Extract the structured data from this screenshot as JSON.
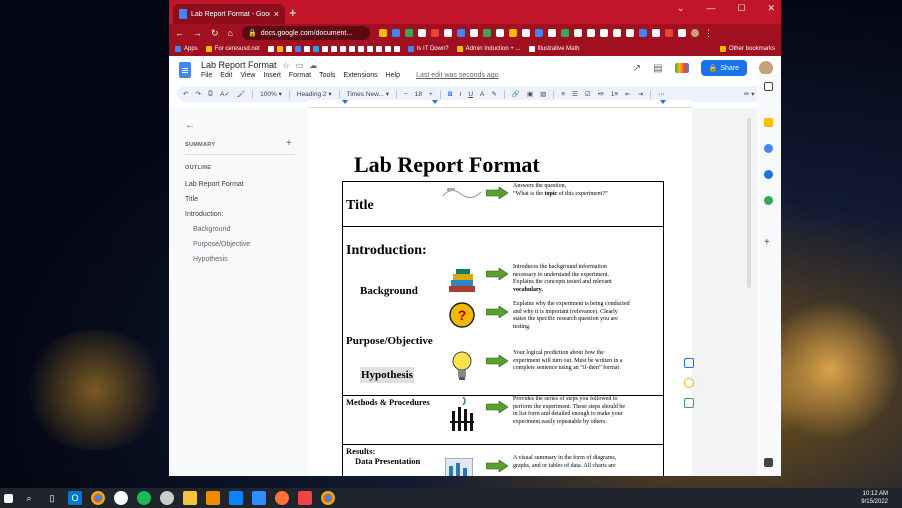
{
  "browser": {
    "tab_title": "Lab Report Format - Google Doc",
    "url": "docs.google.com/document...",
    "bookmarks": [
      "Apps",
      "For ceresusd.net",
      "Is IT Down?",
      "Admin Induction + ...",
      "Illustrative Math",
      "Other bookmarks"
    ]
  },
  "docs": {
    "title": "Lab Report Format",
    "menu": [
      "File",
      "Edit",
      "View",
      "Insert",
      "Format",
      "Tools",
      "Extensions",
      "Help"
    ],
    "last_edit": "Last edit was seconds ago",
    "share_label": "Share",
    "toolbar": {
      "zoom": "100%",
      "style": "Heading 2",
      "font": "Times New...",
      "font_size": "18"
    }
  },
  "outline": {
    "summary_label": "SUMMARY",
    "outline_label": "OUTLINE",
    "items": [
      {
        "label": "Lab Report Format",
        "level": 1
      },
      {
        "label": "Title",
        "level": 1
      },
      {
        "label": "Introduction:",
        "level": 1
      },
      {
        "label": "Background",
        "level": 2
      },
      {
        "label": "Purpose/Objective",
        "level": 2
      },
      {
        "label": "Hypothesis",
        "level": 2
      }
    ]
  },
  "document": {
    "heading": "Lab Report Format",
    "rows": {
      "title": {
        "label": "Title",
        "desc_line1": "Answers the question,",
        "desc_line2_pre": "“What is the ",
        "desc_line2_bold": "topic",
        "desc_line2_post": " of this experiment?”"
      },
      "introduction": {
        "label": "Introduction:"
      },
      "background": {
        "label": "Background",
        "desc": [
          "Introduces the background information",
          "necessary to understand the experiment.",
          "Explains the concepts tested and relevant",
          "vocabulary."
        ]
      },
      "purpose": {
        "label": "Purpose/Objective",
        "desc": [
          "Explains why the experiment is being conducted",
          "and why it is important (relevance).  Clearly",
          "states the specific research question you are",
          "testing."
        ]
      },
      "hypothesis": {
        "label": "Hypothesis",
        "desc": [
          "Your logical prediction about how the",
          "experiment will turn out.  Must be written in a",
          "complete sentence using an “if-then” format"
        ]
      },
      "methods": {
        "label": "Methods & Procedures",
        "desc": [
          "Provides the series of steps you followed to",
          "perform the experiment.  These steps should be",
          "in list form and detailed enough to make your",
          "experiment easily repeatable by others."
        ]
      },
      "results": {
        "label": "Results:",
        "sub": "Data Presentation",
        "desc": [
          "A visual summary in the form of diagrams,",
          "graphs, and or tables of data.  All charts are"
        ]
      }
    }
  },
  "taskbar": {
    "time": "10:12 AM",
    "date": "9/15/2022"
  }
}
